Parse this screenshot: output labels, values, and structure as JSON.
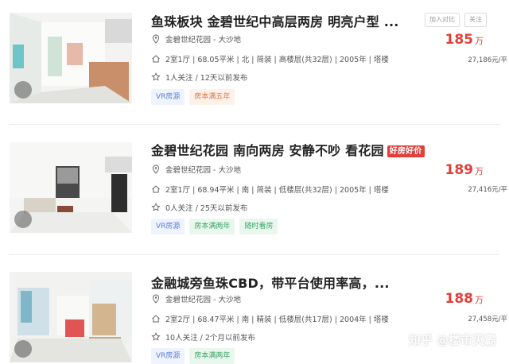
{
  "actions": {
    "compare": "加入对比",
    "follow": "关注"
  },
  "listings": [
    {
      "title": "鱼珠板块 金碧世纪中高层两房 明亮户型 ...",
      "badge": "",
      "community": "金碧世纪花园 - 大沙地",
      "details": "2室1厅 | 68.05平米 | 北 | 简装 | 高楼层(共32层) | 2005年 | 塔楼",
      "follow_info": "1人关注 / 12天以前发布",
      "tags": [
        {
          "label": "VR房源",
          "style": "blue"
        },
        {
          "label": "房本满五年",
          "style": "orange"
        }
      ],
      "price": "185",
      "price_unit": "万",
      "unit_price": "27,186元/平"
    },
    {
      "title": "金碧世纪花园 南向两房 安静不吵 看花园",
      "badge": "好房好价",
      "community": "金碧世纪花园 - 大沙地",
      "details": "2室1厅 | 68.94平米 | 南 | 简装 | 低楼层(共32层) | 2005年 | 塔楼",
      "follow_info": "0人关注 / 25天以前发布",
      "tags": [
        {
          "label": "VR房源",
          "style": "blue"
        },
        {
          "label": "房本满两年",
          "style": "green"
        },
        {
          "label": "随时看房",
          "style": "green"
        }
      ],
      "price": "189",
      "price_unit": "万",
      "unit_price": "27,416元/平"
    },
    {
      "title": "金融城旁鱼珠CBD，带平台使用率高，...",
      "badge": "",
      "community": "金碧世纪花园 - 大沙地",
      "details": "2室2厅 | 68.47平米 | 南 | 精装 | 低楼层(共17层) | 2004年 | 塔楼",
      "follow_info": "10人关注 / 2个月以前发布",
      "tags": [
        {
          "label": "VR房源",
          "style": "blue"
        },
        {
          "label": "房本满两年",
          "style": "green"
        }
      ],
      "price": "188",
      "price_unit": "万",
      "unit_price": "27,458元/平"
    }
  ],
  "watermark": "知乎 @楼市灭霸"
}
